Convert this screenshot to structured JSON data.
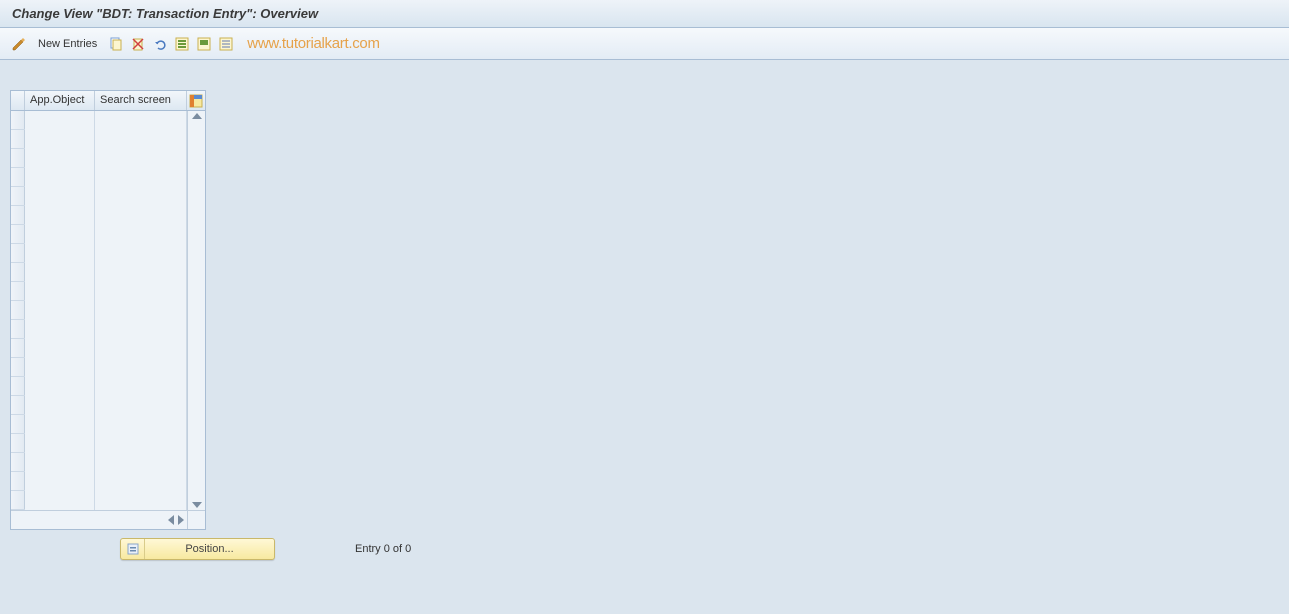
{
  "title": "Change View \"BDT: Transaction Entry\": Overview",
  "toolbar": {
    "new_entries_label": "New Entries"
  },
  "watermark": "www.tutorialkart.com",
  "grid": {
    "columns": [
      "App.Object",
      "Search screen"
    ],
    "row_count": 21
  },
  "footer": {
    "position_label": "Position...",
    "entry_status": "Entry 0 of 0"
  }
}
